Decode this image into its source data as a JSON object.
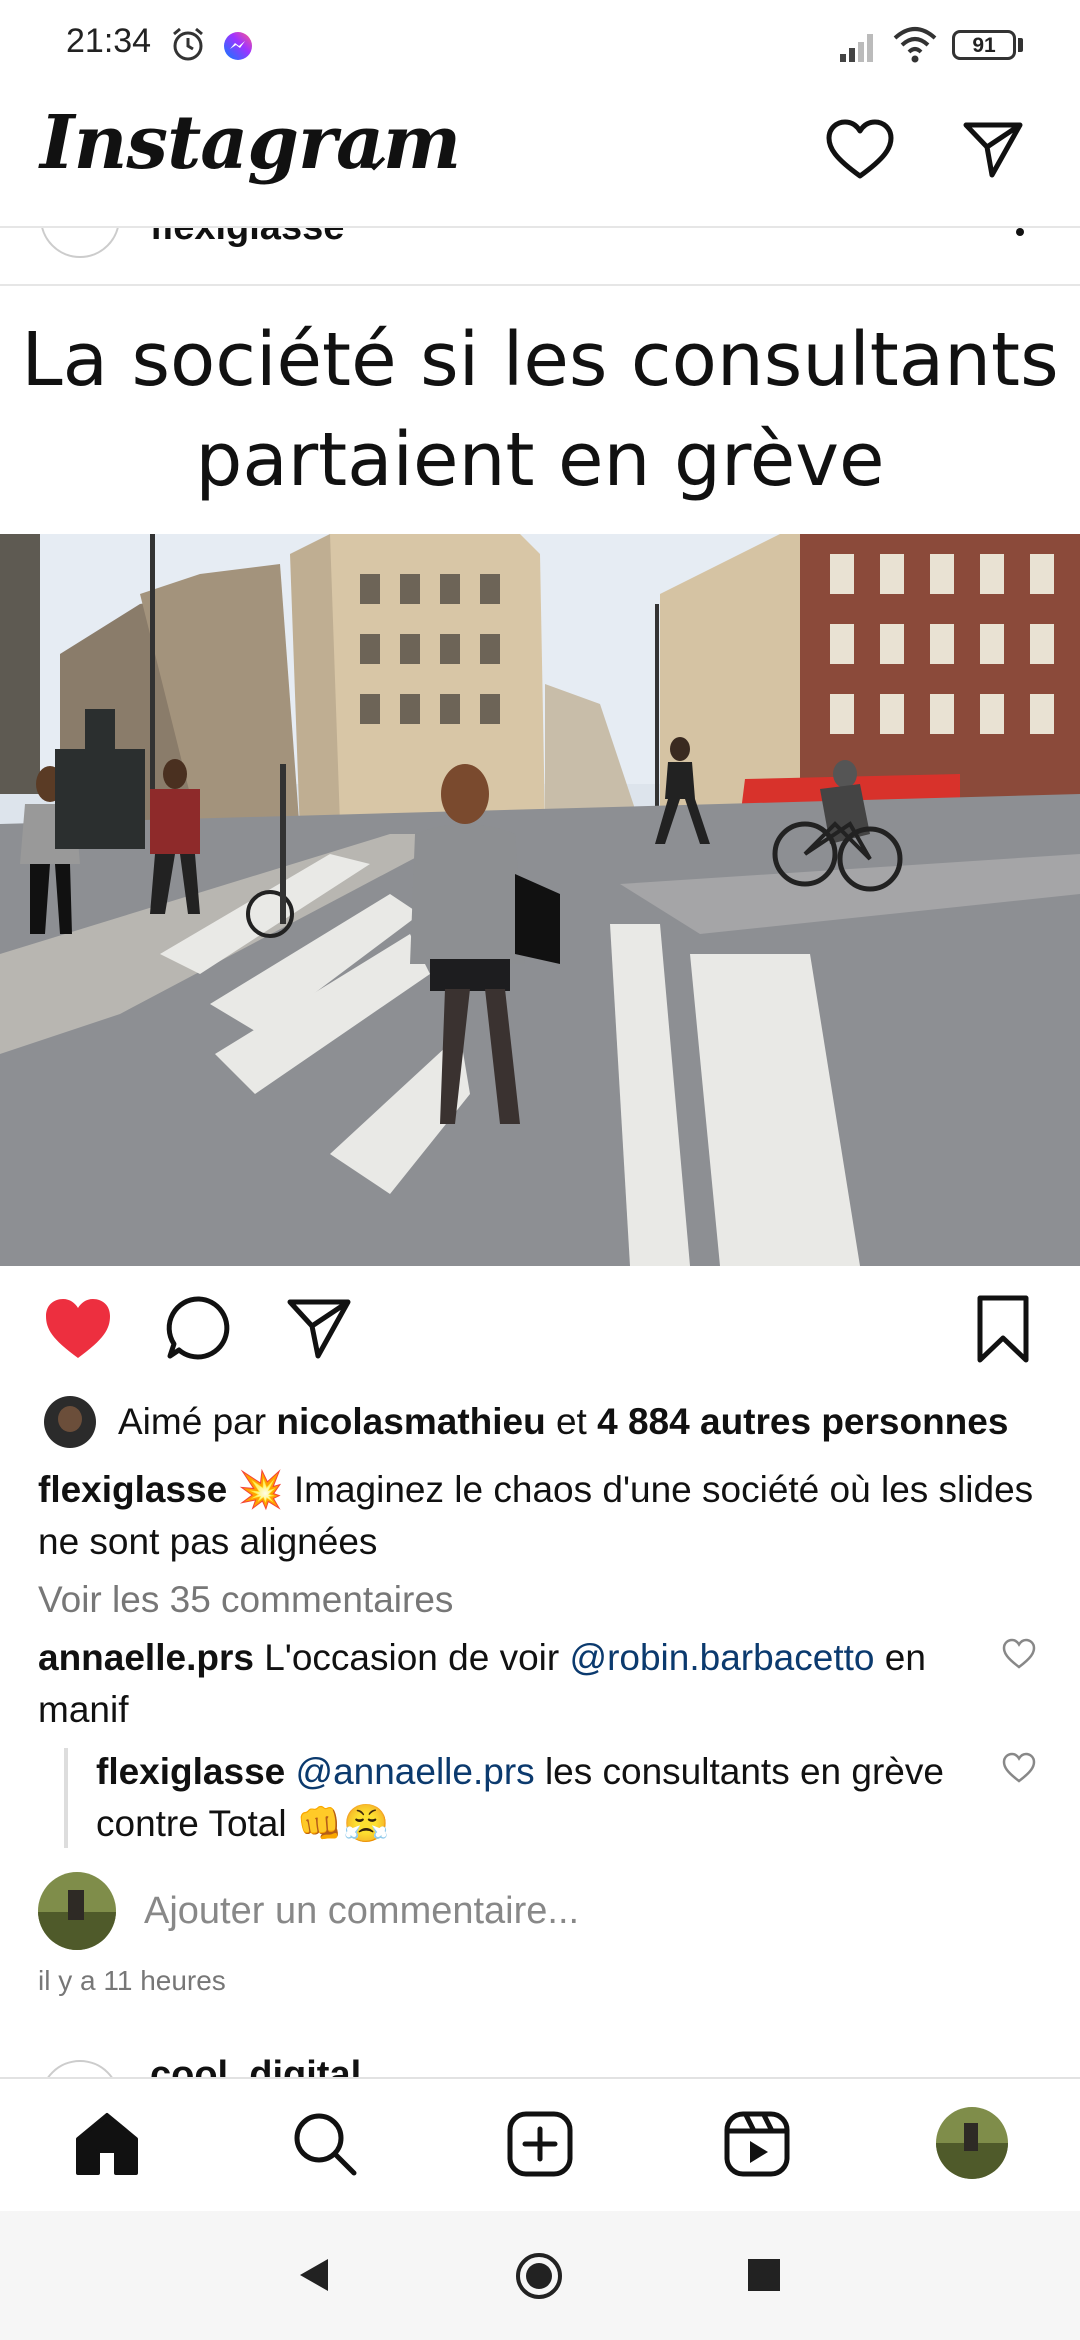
{
  "status_bar": {
    "time": "21:34",
    "battery": "91",
    "icons": [
      "alarm-icon",
      "messenger-icon",
      "signal-icon",
      "wifi-icon",
      "battery-icon"
    ]
  },
  "header": {
    "logo_text": "Instagram",
    "icons": [
      "chevron-down-icon",
      "heart-icon",
      "send-icon"
    ]
  },
  "post": {
    "author_partial": "flexiglasse",
    "image_title_line1": "La société si les consultants",
    "image_title_line2": "partaient en grève",
    "liked_prefix": "Aimé par ",
    "liked_user": "nicolasmathieu",
    "liked_and": " et ",
    "liked_others": "4 884 autres personnes",
    "caption_author": "flexiglasse",
    "caption_emoji": "💥",
    "caption_text": " Imaginez le chaos d'une société où les slides ne sont pas alignées",
    "view_comments": "Voir les 35 commentaires",
    "comments": [
      {
        "author": "annaelle.prs",
        "text_before": " L'occasion de voir ",
        "mention": "@robin.barbacetto",
        "text_after": " en manif"
      },
      {
        "author": "flexiglasse",
        "mention": "@annaelle.prs",
        "text_after": " les consultants en grève contre Total 👊😤"
      }
    ],
    "add_comment_placeholder": "Ajouter un commentaire...",
    "time_ago": "il y a 11 heures",
    "next_author_partial": "cool_digital"
  },
  "colors": {
    "like_red": "#ed2f3f",
    "mention_blue": "#0b3a6e",
    "awning_red": "#d8322b"
  }
}
